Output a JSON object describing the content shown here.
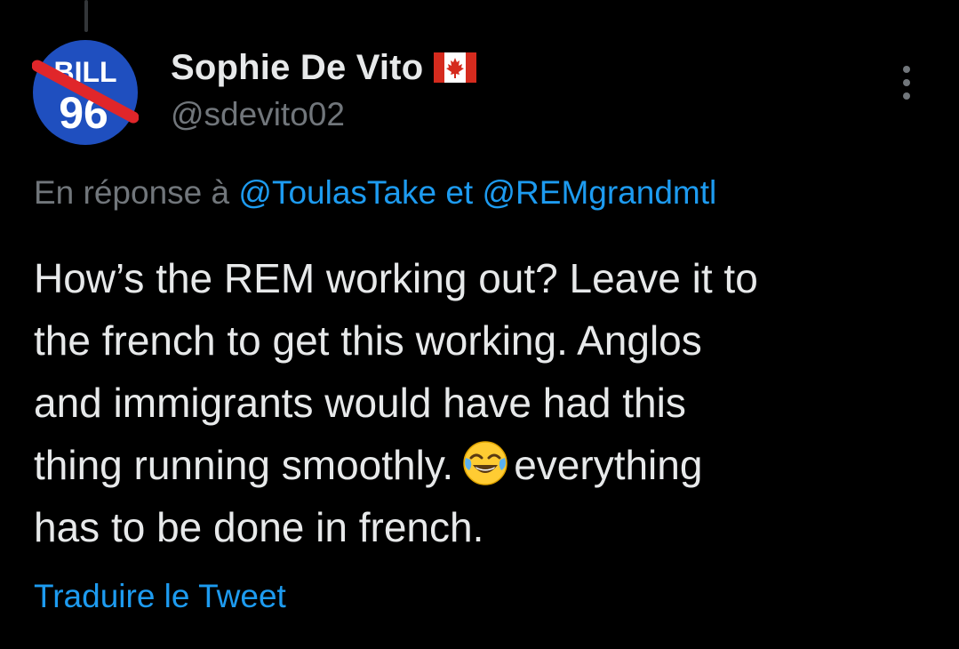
{
  "author": {
    "display_name": "Sophie De Vito",
    "flag_icon": "canada-flag-icon",
    "handle": "@sdevito02",
    "avatar": {
      "icon": "bill-96-crossed-out-logo",
      "text_top": "BILL",
      "text_bottom": "96",
      "colors": {
        "circle": "#1f4fbf",
        "slash": "#e0262a",
        "text": "#ffffff"
      }
    }
  },
  "menu": {
    "icon": "more-options-icon"
  },
  "reply": {
    "prefix": "En réponse à",
    "mention_1": "@ToulasTake",
    "conjunction": "et",
    "mention_2": "@REMgrandmtl"
  },
  "tweet": {
    "line_1": "How’s the REM working out? Leave it to",
    "line_2": "the french to get this working. Anglos",
    "line_3": "and immigrants would have had this",
    "line_4_before_emoji": "thing running smoothly.",
    "emoji": "face-with-tears-of-joy-emoji",
    "line_4_after_emoji": "everything",
    "line_5": "has to be done in french."
  },
  "translate_label": "Traduire le Tweet",
  "colors": {
    "background": "#000000",
    "text_primary": "#e7e9ea",
    "text_secondary": "#71767b",
    "link": "#1d9bf0"
  }
}
